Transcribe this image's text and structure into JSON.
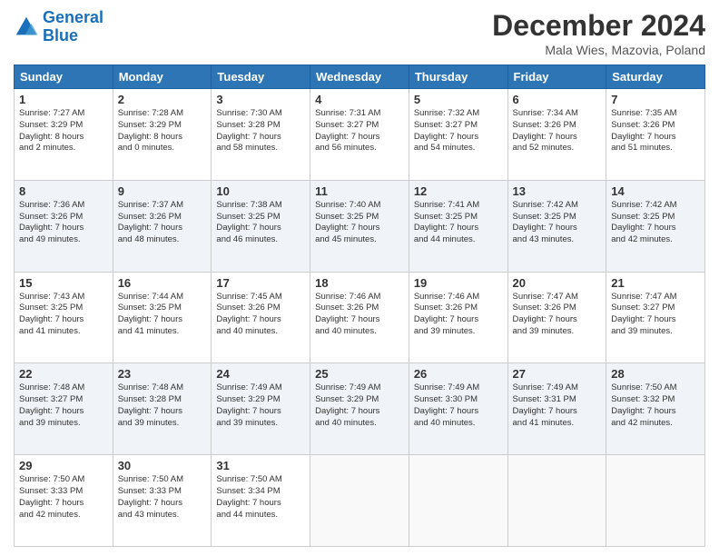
{
  "logo": {
    "line1": "General",
    "line2": "Blue"
  },
  "title": "December 2024",
  "location": "Mala Wies, Mazovia, Poland",
  "days_of_week": [
    "Sunday",
    "Monday",
    "Tuesday",
    "Wednesday",
    "Thursday",
    "Friday",
    "Saturday"
  ],
  "weeks": [
    [
      {
        "day": "1",
        "info": "Sunrise: 7:27 AM\nSunset: 3:29 PM\nDaylight: 8 hours\nand 2 minutes."
      },
      {
        "day": "2",
        "info": "Sunrise: 7:28 AM\nSunset: 3:29 PM\nDaylight: 8 hours\nand 0 minutes."
      },
      {
        "day": "3",
        "info": "Sunrise: 7:30 AM\nSunset: 3:28 PM\nDaylight: 7 hours\nand 58 minutes."
      },
      {
        "day": "4",
        "info": "Sunrise: 7:31 AM\nSunset: 3:27 PM\nDaylight: 7 hours\nand 56 minutes."
      },
      {
        "day": "5",
        "info": "Sunrise: 7:32 AM\nSunset: 3:27 PM\nDaylight: 7 hours\nand 54 minutes."
      },
      {
        "day": "6",
        "info": "Sunrise: 7:34 AM\nSunset: 3:26 PM\nDaylight: 7 hours\nand 52 minutes."
      },
      {
        "day": "7",
        "info": "Sunrise: 7:35 AM\nSunset: 3:26 PM\nDaylight: 7 hours\nand 51 minutes."
      }
    ],
    [
      {
        "day": "8",
        "info": "Sunrise: 7:36 AM\nSunset: 3:26 PM\nDaylight: 7 hours\nand 49 minutes."
      },
      {
        "day": "9",
        "info": "Sunrise: 7:37 AM\nSunset: 3:26 PM\nDaylight: 7 hours\nand 48 minutes."
      },
      {
        "day": "10",
        "info": "Sunrise: 7:38 AM\nSunset: 3:25 PM\nDaylight: 7 hours\nand 46 minutes."
      },
      {
        "day": "11",
        "info": "Sunrise: 7:40 AM\nSunset: 3:25 PM\nDaylight: 7 hours\nand 45 minutes."
      },
      {
        "day": "12",
        "info": "Sunrise: 7:41 AM\nSunset: 3:25 PM\nDaylight: 7 hours\nand 44 minutes."
      },
      {
        "day": "13",
        "info": "Sunrise: 7:42 AM\nSunset: 3:25 PM\nDaylight: 7 hours\nand 43 minutes."
      },
      {
        "day": "14",
        "info": "Sunrise: 7:42 AM\nSunset: 3:25 PM\nDaylight: 7 hours\nand 42 minutes."
      }
    ],
    [
      {
        "day": "15",
        "info": "Sunrise: 7:43 AM\nSunset: 3:25 PM\nDaylight: 7 hours\nand 41 minutes."
      },
      {
        "day": "16",
        "info": "Sunrise: 7:44 AM\nSunset: 3:25 PM\nDaylight: 7 hours\nand 41 minutes."
      },
      {
        "day": "17",
        "info": "Sunrise: 7:45 AM\nSunset: 3:26 PM\nDaylight: 7 hours\nand 40 minutes."
      },
      {
        "day": "18",
        "info": "Sunrise: 7:46 AM\nSunset: 3:26 PM\nDaylight: 7 hours\nand 40 minutes."
      },
      {
        "day": "19",
        "info": "Sunrise: 7:46 AM\nSunset: 3:26 PM\nDaylight: 7 hours\nand 39 minutes."
      },
      {
        "day": "20",
        "info": "Sunrise: 7:47 AM\nSunset: 3:26 PM\nDaylight: 7 hours\nand 39 minutes."
      },
      {
        "day": "21",
        "info": "Sunrise: 7:47 AM\nSunset: 3:27 PM\nDaylight: 7 hours\nand 39 minutes."
      }
    ],
    [
      {
        "day": "22",
        "info": "Sunrise: 7:48 AM\nSunset: 3:27 PM\nDaylight: 7 hours\nand 39 minutes."
      },
      {
        "day": "23",
        "info": "Sunrise: 7:48 AM\nSunset: 3:28 PM\nDaylight: 7 hours\nand 39 minutes."
      },
      {
        "day": "24",
        "info": "Sunrise: 7:49 AM\nSunset: 3:29 PM\nDaylight: 7 hours\nand 39 minutes."
      },
      {
        "day": "25",
        "info": "Sunrise: 7:49 AM\nSunset: 3:29 PM\nDaylight: 7 hours\nand 40 minutes."
      },
      {
        "day": "26",
        "info": "Sunrise: 7:49 AM\nSunset: 3:30 PM\nDaylight: 7 hours\nand 40 minutes."
      },
      {
        "day": "27",
        "info": "Sunrise: 7:49 AM\nSunset: 3:31 PM\nDaylight: 7 hours\nand 41 minutes."
      },
      {
        "day": "28",
        "info": "Sunrise: 7:50 AM\nSunset: 3:32 PM\nDaylight: 7 hours\nand 42 minutes."
      }
    ],
    [
      {
        "day": "29",
        "info": "Sunrise: 7:50 AM\nSunset: 3:33 PM\nDaylight: 7 hours\nand 42 minutes."
      },
      {
        "day": "30",
        "info": "Sunrise: 7:50 AM\nSunset: 3:33 PM\nDaylight: 7 hours\nand 43 minutes."
      },
      {
        "day": "31",
        "info": "Sunrise: 7:50 AM\nSunset: 3:34 PM\nDaylight: 7 hours\nand 44 minutes."
      },
      {
        "day": "",
        "info": ""
      },
      {
        "day": "",
        "info": ""
      },
      {
        "day": "",
        "info": ""
      },
      {
        "day": "",
        "info": ""
      }
    ]
  ]
}
